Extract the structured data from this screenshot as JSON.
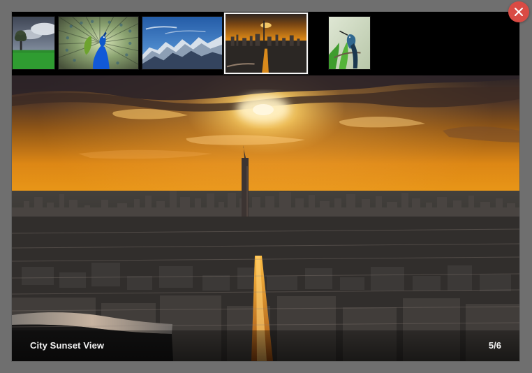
{
  "gallery": {
    "caption": "City Sunset View",
    "counter": "5/6",
    "active_index": 4,
    "accent_color": "#d94b44",
    "thumbnails": [
      {
        "name": "landscape-tree"
      },
      {
        "name": "peacock"
      },
      {
        "name": "snowy-mountains"
      },
      {
        "name": "city-sunset"
      },
      {
        "name": "hummingbird"
      }
    ]
  },
  "icons": {
    "close": "close-icon"
  }
}
